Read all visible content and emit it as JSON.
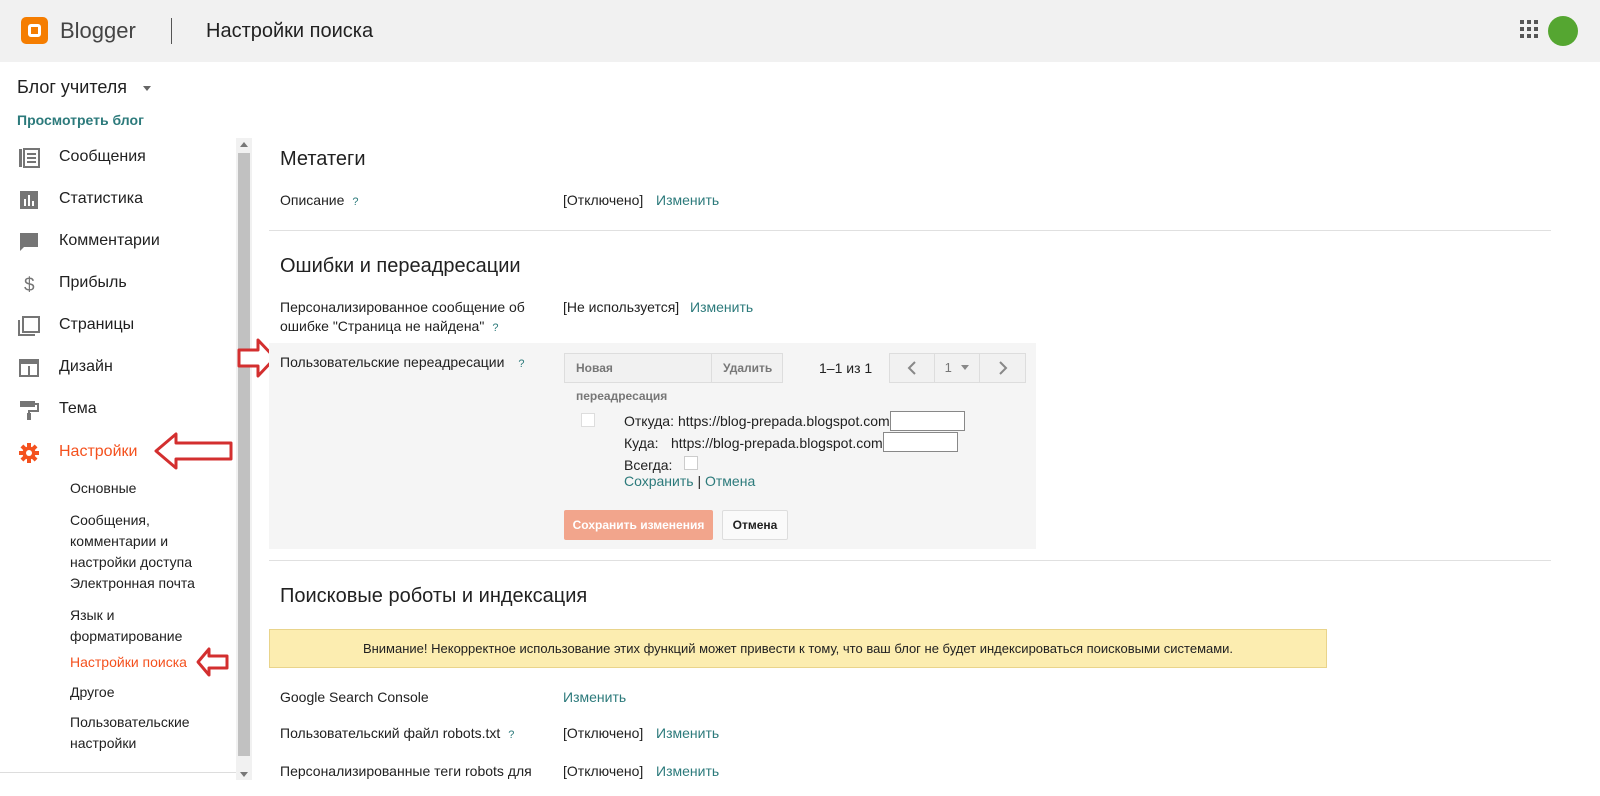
{
  "topbar": {
    "brand": "Blogger",
    "page_title": "Настройки поиска",
    "apps_icon": "apps-grid-icon",
    "avatar_color": "#55a631"
  },
  "sidebar": {
    "blog_name": "Блог учителя",
    "view_blog": "Просмотреть блог",
    "items": [
      {
        "label": "Сообщения",
        "icon": "posts-icon"
      },
      {
        "label": "Статистика",
        "icon": "stats-icon"
      },
      {
        "label": "Комментарии",
        "icon": "comments-icon"
      },
      {
        "label": "Прибыль",
        "icon": "dollar-icon"
      },
      {
        "label": "Страницы",
        "icon": "pages-icon"
      },
      {
        "label": "Дизайн",
        "icon": "layout-icon"
      },
      {
        "label": "Тема",
        "icon": "theme-brush-icon"
      },
      {
        "label": "Настройки",
        "icon": "gear-icon",
        "active": true
      }
    ],
    "sub_items": [
      {
        "label": "Основные"
      },
      {
        "label": "Сообщения, комментарии и настройки доступа"
      },
      {
        "label": "Электронная почта"
      },
      {
        "label": "Язык и форматирование"
      },
      {
        "label": "Настройки поиска",
        "active": true
      },
      {
        "label": "Другое"
      },
      {
        "label": "Пользовательские настройки"
      }
    ]
  },
  "meta": {
    "title": "Метатеги",
    "description_label": "Описание",
    "description_value": "[Отключено]",
    "change": "Изменить"
  },
  "errors": {
    "title": "Ошибки и переадресации",
    "not_found_label": "Персонализированное сообщение об ошибке \"Страница не найдена\"",
    "not_found_value": "[Не используется]",
    "change": "Изменить",
    "redirects_label": "Пользовательские переадресации",
    "new_redirect": "Новая переадресация",
    "delete": "Удалить",
    "pager_text": "1–1 из 1",
    "page_number": "1",
    "from_label": "Откуда:",
    "from_url": "https://blog-prepada.blogspot.com",
    "to_label": "Куда:",
    "to_url": "https://blog-prepada.blogspot.com",
    "always_label": "Всегда:",
    "save_link": "Сохранить",
    "separator": "|",
    "cancel_link": "Отмена",
    "save_changes": "Сохранить изменения",
    "cancel": "Отмена"
  },
  "robots": {
    "title": "Поисковые роботы и индексация",
    "warning": "Внимание! Некорректное использование этих функций может привести к тому, что ваш блог не будет индексироваться поисковыми системами.",
    "gsc_label": "Google Search Console",
    "change": "Изменить",
    "robots_txt_label": "Пользовательский файл robots.txt",
    "robots_txt_value": "[Отключено]",
    "robots_tags_label": "Персонализированные теги robots для",
    "robots_tags_value": "[Отключено]"
  },
  "colors": {
    "accent": "#f4511e",
    "link": "#2c7a7b",
    "annotation_arrow": "#d32f2f",
    "warning_bg": "#fcedb0"
  }
}
